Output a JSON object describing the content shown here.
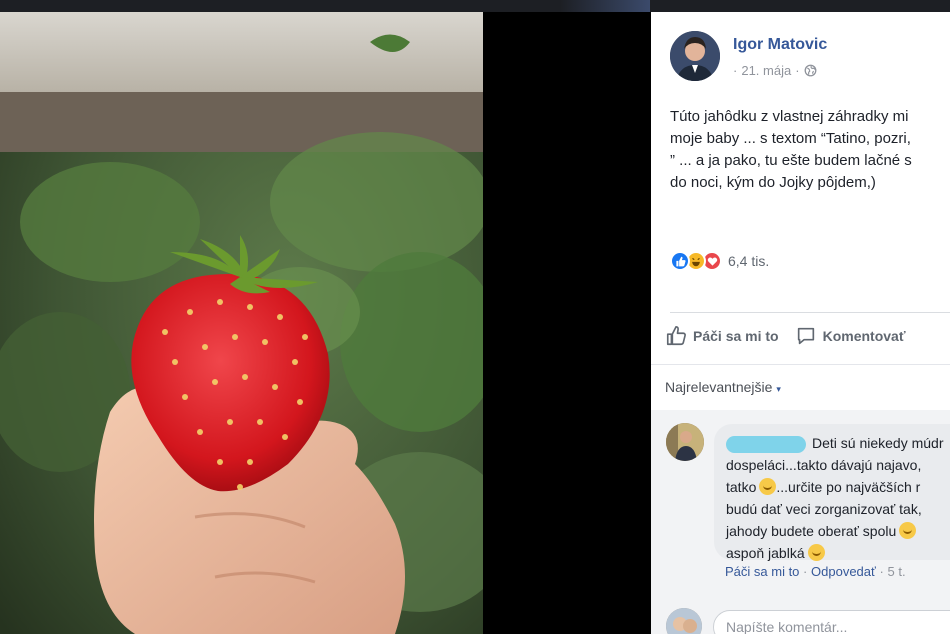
{
  "post": {
    "author": "Igor Matovic",
    "date": "21. mája",
    "separator": "·",
    "text_lines": [
      "Túto jahôdku z vlastnej záhradky mi",
      "moje baby ... s textom “Tatino, pozri,",
      "” ... a ja pako, tu ešte budem lačné s",
      "do noci, kým do Jojky pôjdem,)"
    ],
    "reactions_count": "6,4 tis.",
    "reaction_icons": [
      "like-icon",
      "haha-icon",
      "love-icon"
    ]
  },
  "actions": {
    "like_label": "Páči sa mi to",
    "comment_label": "Komentovať"
  },
  "sort": {
    "label": "Najrelevantnejšie",
    "arrow": "▾"
  },
  "comment": {
    "lines": [
      "Deti sú niekedy múdr",
      "dospeláci...takto dávajú najavo,",
      "tatko",
      "...určite po najväčších r",
      "budú dať veci zorganizovať tak,",
      "jahody budete oberať spolu",
      "aspoň jablká"
    ],
    "like_link": "Páči sa mi to",
    "reply_link": "Odpovedať",
    "sep": "·",
    "age": "5 t."
  },
  "reply_box": {
    "placeholder": "Napíšte komentár..."
  },
  "colors": {
    "link_blue": "#365899",
    "panel_bg": "#ffffff",
    "comment_bubble": "#e9ebee"
  }
}
